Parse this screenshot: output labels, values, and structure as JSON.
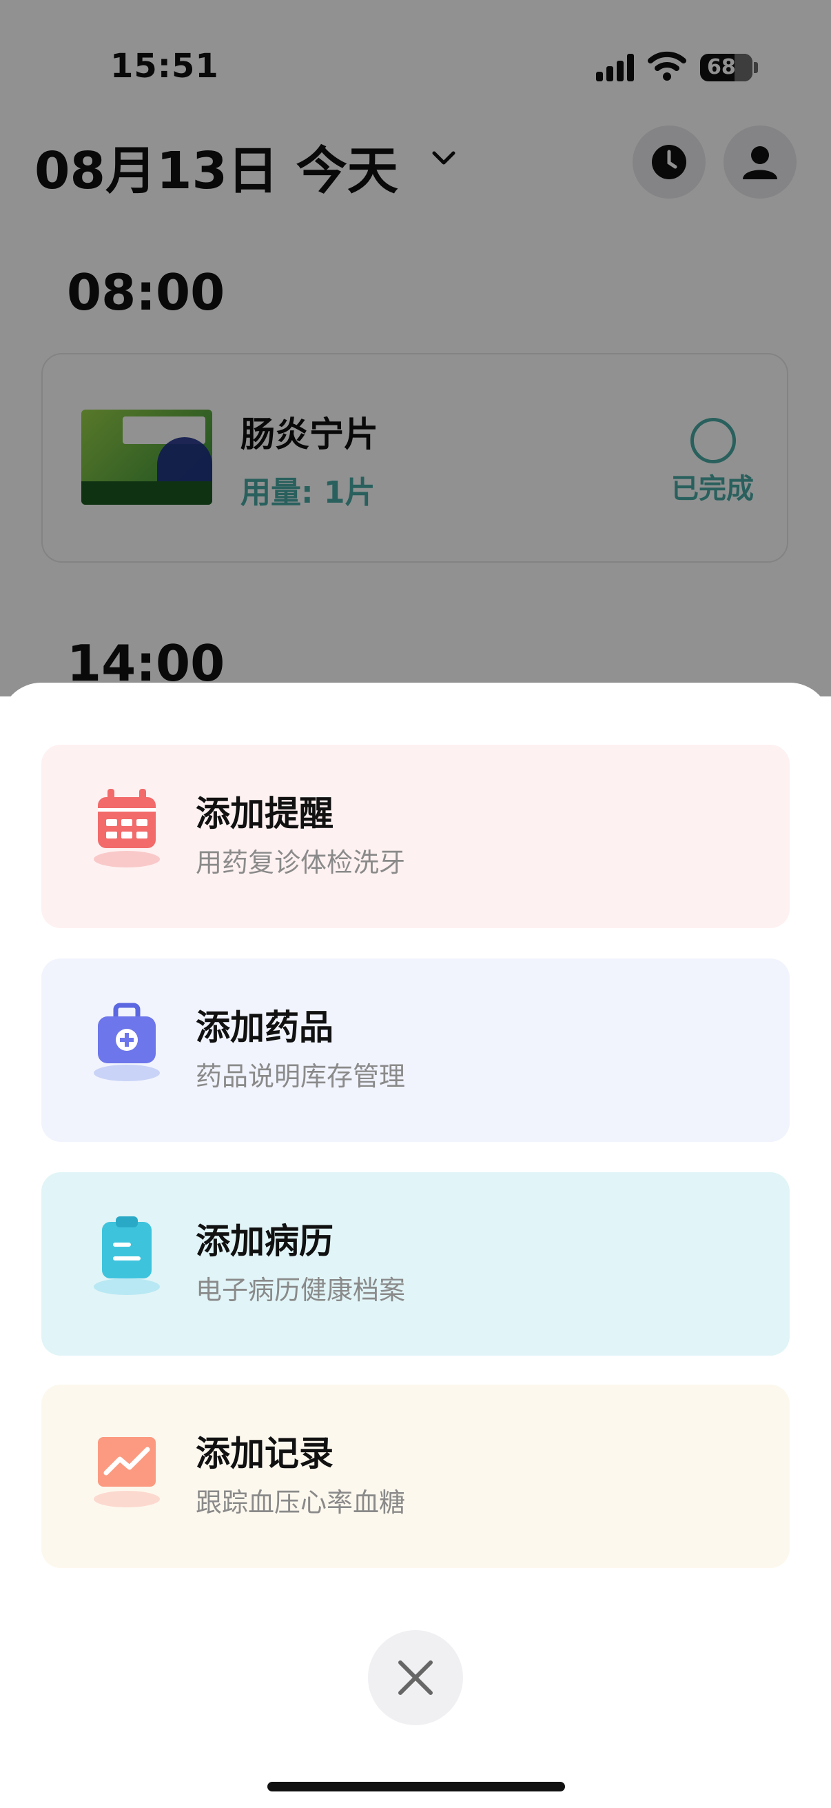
{
  "status_bar": {
    "time": "15:51",
    "battery": "68"
  },
  "header": {
    "date_title": "08月13日 今天"
  },
  "timeline": [
    {
      "time": "08:00",
      "medication": {
        "name": "肠炎宁片",
        "dose": "用量: 1片",
        "status": "已完成"
      }
    },
    {
      "time": "14:00"
    }
  ],
  "sheet": {
    "options": [
      {
        "title": "添加提醒",
        "subtitle": "用药复诊体检洗牙",
        "icon": "calendar-icon",
        "bg": "#fef1f1"
      },
      {
        "title": "添加药品",
        "subtitle": "药品说明库存管理",
        "icon": "medicine-kit-icon",
        "bg": "#f1f4fd"
      },
      {
        "title": "添加病历",
        "subtitle": "电子病历健康档案",
        "icon": "clipboard-icon",
        "bg": "#e1f4f7"
      },
      {
        "title": "添加记录",
        "subtitle": "跟踪血压心率血糖",
        "icon": "chart-trend-icon",
        "bg": "#fdf8ee"
      }
    ]
  },
  "colors": {
    "accent_teal": "#49a9a4",
    "overlay": "rgba(0,0,0,0.43)"
  }
}
